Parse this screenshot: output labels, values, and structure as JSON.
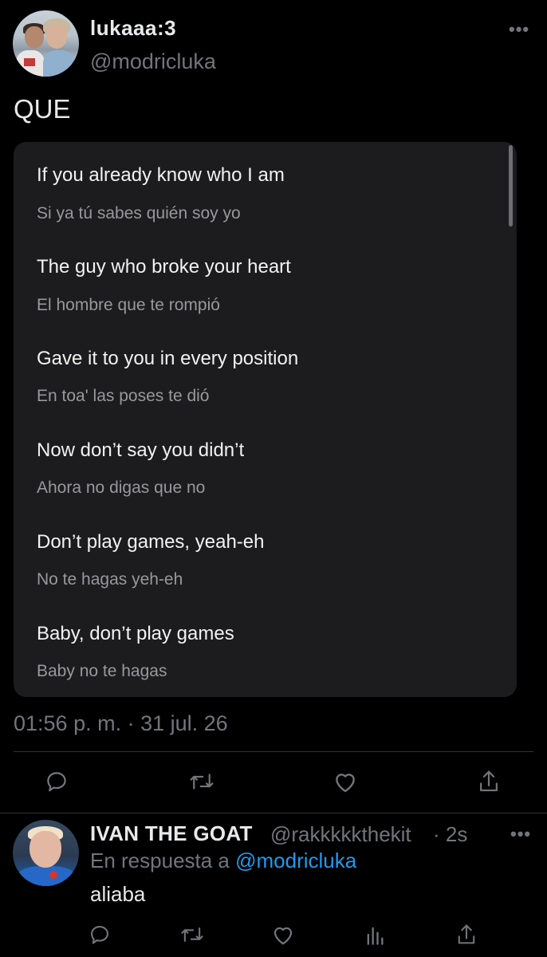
{
  "tweet": {
    "display_name": "lukaaa:3",
    "handle": "@modricluka",
    "more_icon": "•••",
    "text": "QUE",
    "timestamp": "01:56 p. m. · 31 jul. 26",
    "lyrics": [
      {
        "en": "If you already know who I am",
        "es": "Si ya tú sabes quién soy yo"
      },
      {
        "en": "The guy who broke your heart",
        "es": "El hombre que te rompió"
      },
      {
        "en": "Gave it to you in every position",
        "es": "En toa' las poses te dió"
      },
      {
        "en": "Now don’t say you didn’t",
        "es": "Ahora no digas que no"
      },
      {
        "en": "Don’t play games, yeah-eh",
        "es": "No te hagas yeh-eh"
      },
      {
        "en": "Baby, don’t play games",
        "es": "Baby no te hagas"
      }
    ],
    "actions": [
      "reply-icon",
      "retweet-icon",
      "like-icon",
      "share-icon"
    ]
  },
  "reply": {
    "display_name": "IVAN THE GOAT",
    "handle": "@rakkkkkthekit",
    "time": "· 2s",
    "more_icon": "•••",
    "in_reply_to_prefix": "En respuesta a",
    "in_reply_to_handle": "@modricluka",
    "text": "aliaba",
    "actions": [
      "reply-icon",
      "retweet-icon",
      "like-icon",
      "analytics-icon",
      "share-icon"
    ]
  },
  "colors": {
    "background": "#000000",
    "text": "#e7e9ea",
    "secondary": "#71767b",
    "link": "#1d9bf0",
    "card": "#1c1c1e"
  }
}
